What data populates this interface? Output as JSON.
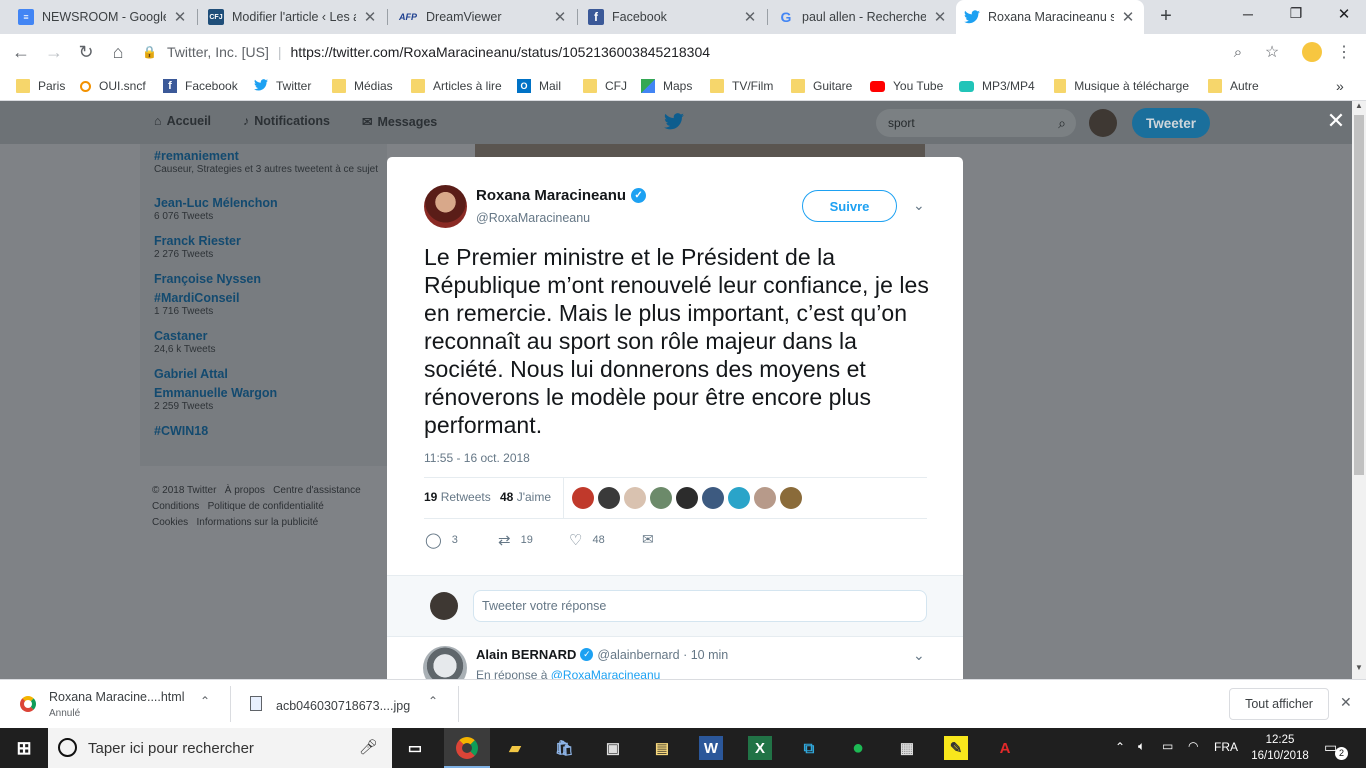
{
  "tabs": [
    {
      "title": "NEWSROOM - Google",
      "icon": "docs-icon",
      "color": "#4285f4"
    },
    {
      "title": "Modifier l'article ‹ Les a",
      "icon": "cfj-icon",
      "color": "#1f4e79"
    },
    {
      "title": "DreamViewer",
      "icon": "afp-icon",
      "color": "#1d3f8f"
    },
    {
      "title": "Facebook",
      "icon": "facebook-icon",
      "color": "#3b5998"
    },
    {
      "title": "paul allen - Recherche G",
      "icon": "google-icon",
      "color": "#4285f4"
    },
    {
      "title": "Roxana Maracineanu su",
      "icon": "twitter-icon",
      "color": "#1da1f2"
    }
  ],
  "omnibox": {
    "site": "Twitter, Inc. [US]",
    "url": "https://twitter.com/RoxaMaracineanu/status/1052136003845218304"
  },
  "bookmarks": [
    {
      "label": "Paris",
      "icon": "folder-icon"
    },
    {
      "label": "OUI.sncf",
      "icon": "sncf-icon"
    },
    {
      "label": "Facebook",
      "icon": "facebook-icon"
    },
    {
      "label": "Twitter",
      "icon": "twitter-icon"
    },
    {
      "label": "Médias",
      "icon": "folder-icon"
    },
    {
      "label": "Articles à lire",
      "icon": "folder-icon"
    },
    {
      "label": "Mail",
      "icon": "outlook-icon"
    },
    {
      "label": "CFJ",
      "icon": "folder-icon"
    },
    {
      "label": "Maps",
      "icon": "maps-icon"
    },
    {
      "label": "TV/Film",
      "icon": "folder-icon"
    },
    {
      "label": "Guitare",
      "icon": "folder-icon"
    },
    {
      "label": "You Tube",
      "icon": "youtube-icon"
    },
    {
      "label": "MP3/MP4",
      "icon": "mp3-icon"
    },
    {
      "label": "Musique à télécharge",
      "icon": "folder-icon"
    },
    {
      "label": "Autre",
      "icon": "folder-icon"
    }
  ],
  "twitter_nav": {
    "home": "Accueil",
    "notifications": "Notifications",
    "messages": "Messages",
    "search_value": "sport",
    "tweet_button": "Tweeter"
  },
  "trends": [
    {
      "name": "#remaniement",
      "sub": "Causeur, Strategies et 3 autres tweetent à ce sujet"
    },
    {
      "name": "Jean-Luc Mélenchon",
      "sub": "6 076 Tweets"
    },
    {
      "name": "Franck Riester",
      "sub": "2 276 Tweets"
    },
    {
      "name": "Françoise Nyssen",
      "sub": ""
    },
    {
      "name": "#MardiConseil",
      "sub": "1 716 Tweets"
    },
    {
      "name": "Castaner",
      "sub": "24,6 k Tweets"
    },
    {
      "name": "Gabriel Attal",
      "sub": ""
    },
    {
      "name": "Emmanuelle Wargon",
      "sub": "2 259 Tweets"
    },
    {
      "name": "#CWIN18",
      "sub": ""
    }
  ],
  "footer": {
    "line1": [
      "© 2018 Twitter",
      "À propos",
      "Centre d'assistance"
    ],
    "line2": [
      "Conditions",
      "Politique de confidentialité"
    ],
    "line3": [
      "Cookies",
      "Informations sur la publicité"
    ]
  },
  "tweet": {
    "author": "Roxana Maracineanu",
    "handle": "@RoxaMaracineanu",
    "follow": "Suivre",
    "text": "Le Premier ministre et le Président de la République m’ont renouvelé leur confiance, je les en remercie. Mais le plus important, c’est qu’on reconnaît au sport son rôle majeur dans la société. Nous lui donnerons des moyens et rénoverons le modèle pour être encore plus performant.",
    "time": "11:55 - 16 oct. 2018",
    "retweets_count": "19",
    "retweets_label": "Retweets",
    "likes_count": "48",
    "likes_label": "J'aime",
    "reply_count": "3",
    "retweet_count": "19",
    "like_count": "48",
    "reply_placeholder": "Tweeter votre réponse"
  },
  "reply": {
    "author": "Alain BERNARD",
    "handle": "@alainbernard",
    "time": "· 10 min",
    "in_reply": "En réponse à",
    "in_reply_to": "@RoxaMaracineanu"
  },
  "downloads": [
    {
      "name": "Roxana Maracine....html",
      "status": "Annulé"
    },
    {
      "name": "acb046030718673....jpg",
      "status": ""
    }
  ],
  "show_all": "Tout afficher",
  "taskbar": {
    "search_placeholder": "Taper ici pour rechercher",
    "lang": "FRA",
    "time": "12:25",
    "date": "16/10/2018",
    "notif_count": "2"
  }
}
